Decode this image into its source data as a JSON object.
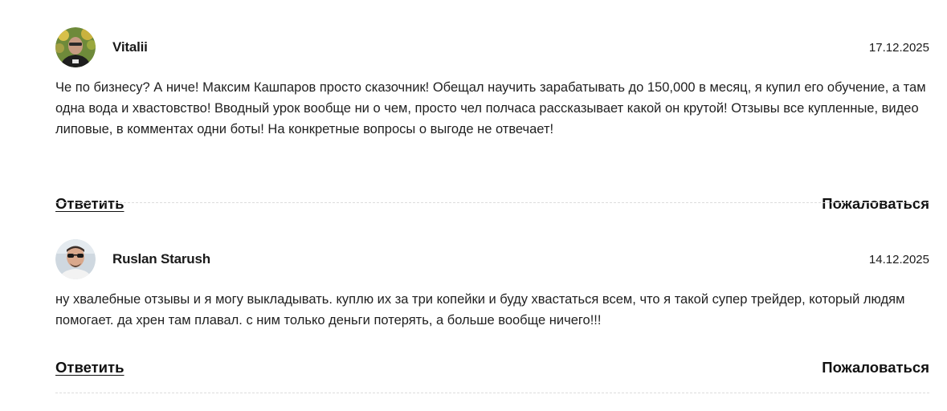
{
  "comments": [
    {
      "author": "Vitalii",
      "date": "17.12.2025",
      "text": "Че по бизнесу? А ниче! Максим Кашпаров просто сказочник! Обещал научить зарабатывать до 150,000 в месяц, я купил его обучение, а там одна вода и хвастовство! Вводный урок вообще ни о чем, просто чел полчаса рассказывает какой он крутой! Отзывы все купленные, видео липовые, в комментах одни боты! На конкретные вопросы о выгоде не отвечает!",
      "reply_label": "Ответить",
      "report_label": "Пожаловаться",
      "avatar_icon": "user-photo-avatar"
    },
    {
      "author": "Ruslan Starush",
      "date": "14.12.2025",
      "text": "ну хвалебные отзывы и я могу выкладывать. куплю их за три копейки и буду хвастаться всем, что я такой супер трейдер, который людям помогает. да хрен там плавал. с ним только деньги потерять, а больше вообще ничего!!!",
      "reply_label": "Ответить",
      "report_label": "Пожаловаться",
      "avatar_icon": "user-photo-avatar"
    }
  ]
}
